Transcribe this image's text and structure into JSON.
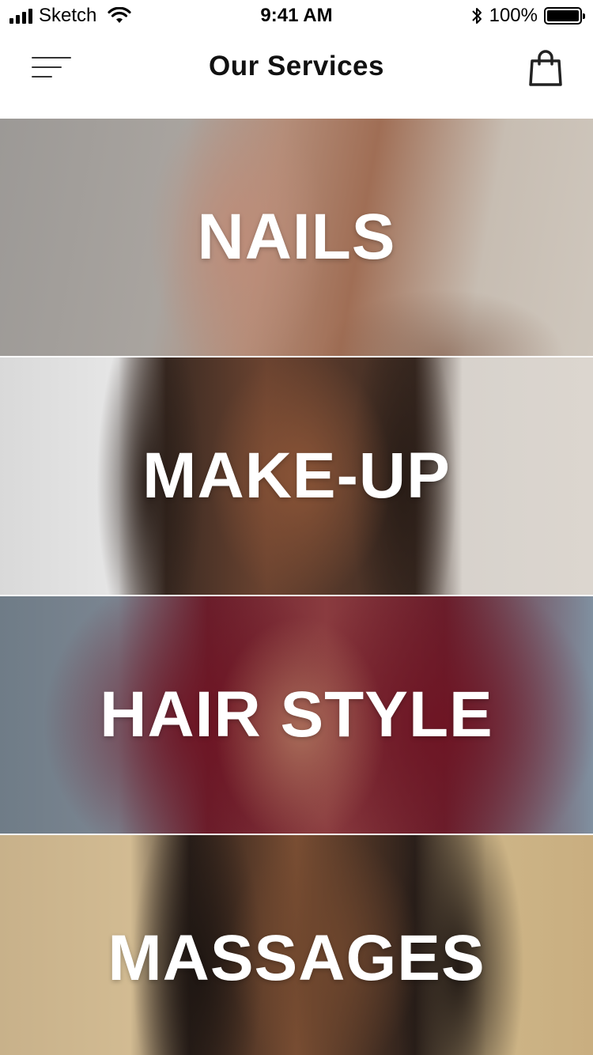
{
  "status_bar": {
    "carrier": "Sketch",
    "time": "9:41 AM",
    "battery": "100%",
    "icons": [
      "signal-icon",
      "wifi-icon",
      "bluetooth-icon",
      "battery-icon"
    ]
  },
  "nav": {
    "title": "Our Services",
    "menu_icon": "hamburger-menu-icon",
    "cart_icon": "shopping-bag-icon"
  },
  "services": [
    {
      "label": "NAILS"
    },
    {
      "label": "MAKE-UP"
    },
    {
      "label": "HAIR STYLE"
    },
    {
      "label": "MASSAGES"
    }
  ],
  "colors": {
    "background": "#ffffff",
    "text_dark": "#111111",
    "tile_label": "#ffffff"
  }
}
